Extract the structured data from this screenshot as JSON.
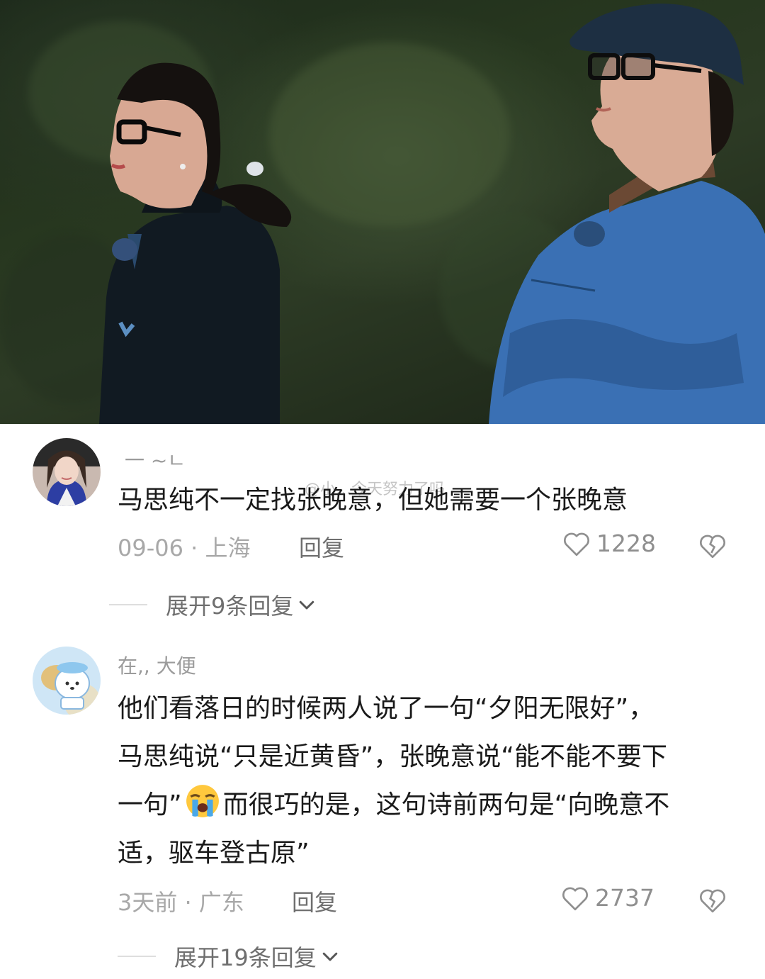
{
  "watermark": "@小…今天努力了吗",
  "comments": [
    {
      "username": "一 ~ㄴ",
      "text": "马思纯不一定找张晚意，但她需要一个张晚意",
      "date": "09-06",
      "location": "上海",
      "reply_label": "回复",
      "likes": "1228",
      "expand_label": "展开9条回复"
    },
    {
      "username": "在,,                        大便",
      "text_lines": [
        "他们看落日的时候两人说了一句“夕阳无限好”，",
        "马思纯说“只是近黄昏”，张晚意说“能不能不要下",
        "一句”",
        "而很巧的是，这句诗前两句是“向晚意不",
        "适，驱车登古原”"
      ],
      "date": "3天前",
      "location": "广东",
      "reply_label": "回复",
      "likes": "2737",
      "expand_label": "展开19条回复"
    }
  ],
  "icons": {
    "like": "heart-outline-icon",
    "dislike": "broken-heart-icon",
    "expand": "chevron-down-icon",
    "emoji": "loudly-crying-face-emoji"
  }
}
